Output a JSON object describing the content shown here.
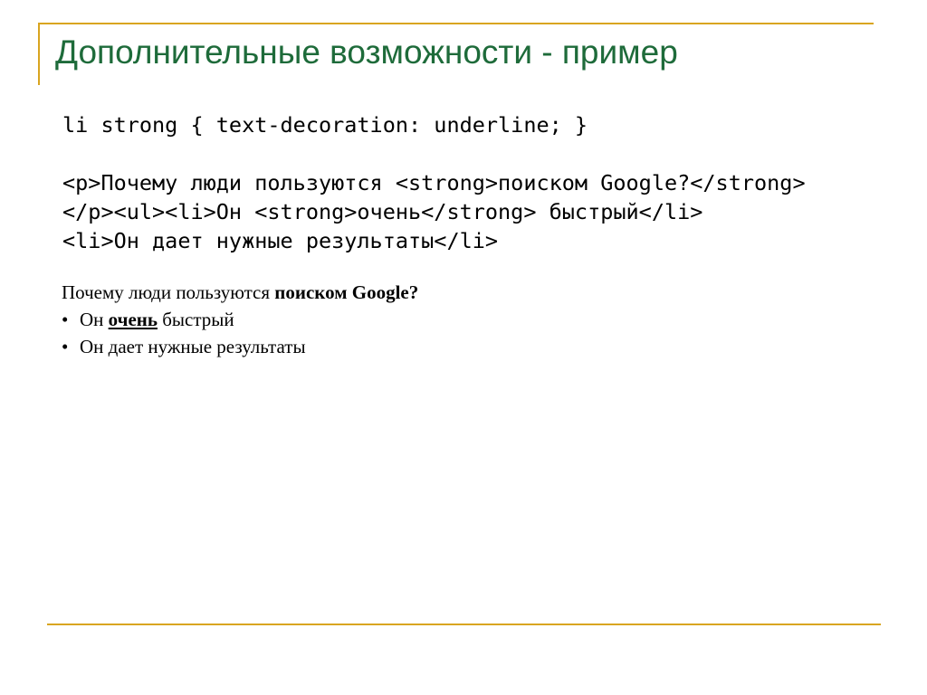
{
  "slide": {
    "title": "Дополнительные возможности - пример"
  },
  "code": {
    "css_line": "li strong { text-decoration: underline; }",
    "html_lines": [
      "<p>Почему люди пользуются <strong>поиском Google?</strong>",
      "</p><ul><li>Он <strong>очень</strong> быстрый</li>",
      "<li>Он дает нужные результаты</li>"
    ]
  },
  "rendered": {
    "paragraph_text": "Почему люди пользуются ",
    "paragraph_strong": "поиском Google?",
    "bullet_glyph": "•",
    "items": [
      {
        "before": "Он ",
        "strong": "очень",
        "after": " быстрый"
      },
      {
        "text": "Он дает нужные результаты"
      }
    ]
  },
  "colors": {
    "title": "#1e6b3a",
    "rules": "#d9a520"
  }
}
